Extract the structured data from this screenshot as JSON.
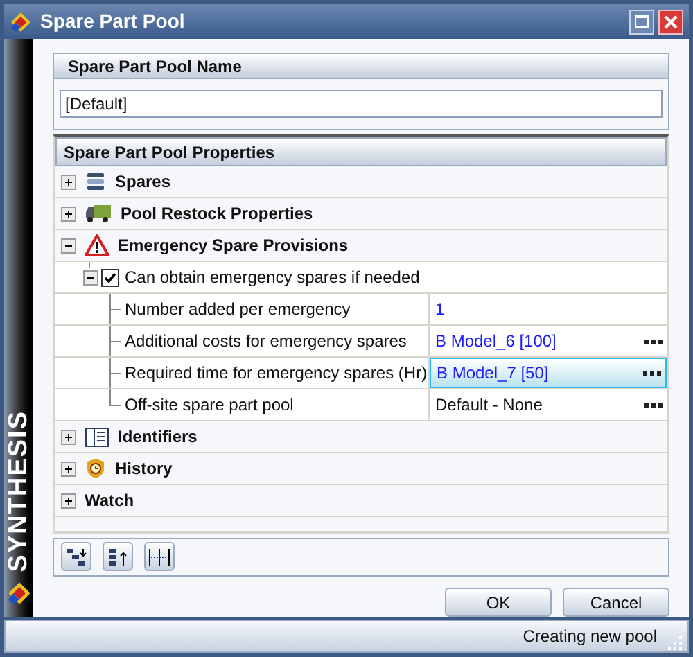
{
  "window": {
    "title": "Spare Part Pool",
    "brand": "SYNTHESIS"
  },
  "name_section": {
    "title": "Spare Part Pool Name",
    "value": "[Default]"
  },
  "properties": {
    "title": "Spare Part Pool Properties",
    "categories": [
      {
        "label": "Spares",
        "expanded": false
      },
      {
        "label": "Pool Restock Properties",
        "expanded": false
      },
      {
        "label": "Emergency Spare Provisions",
        "expanded": true,
        "children": [
          {
            "label": "Can obtain emergency spares if needed",
            "checked": true,
            "expanded": true,
            "children": [
              {
                "label": "Number added per emergency",
                "value": "1",
                "kind": "linked",
                "selected": false,
                "browse": false
              },
              {
                "label": "Additional costs for emergency spares",
                "value": "B Model_6 [100]",
                "kind": "linked",
                "selected": false,
                "browse": true
              },
              {
                "label": "Required time for emergency spares (Hr)",
                "value": "B Model_7 [50]",
                "kind": "linked",
                "selected": true,
                "browse": true
              },
              {
                "label": "Off-site spare part pool",
                "value": "Default - None",
                "kind": "default",
                "selected": false,
                "browse": true
              }
            ]
          }
        ]
      },
      {
        "label": "Identifiers",
        "expanded": false
      },
      {
        "label": "History",
        "expanded": false
      },
      {
        "label": "Watch",
        "expanded": false
      }
    ]
  },
  "buttons": [
    {
      "label": "OK"
    },
    {
      "label": "Cancel"
    }
  ],
  "status_bar": {
    "text": "Creating new pool"
  }
}
